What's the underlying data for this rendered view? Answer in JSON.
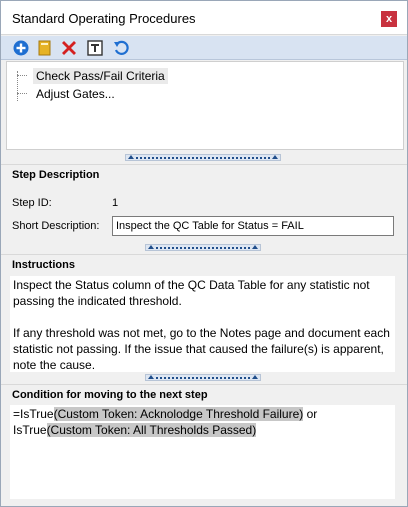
{
  "window": {
    "title": "Standard Operating Procedures",
    "close_label": "x"
  },
  "toolbar": {
    "buttons": [
      {
        "name": "add-icon"
      },
      {
        "name": "folder-icon"
      },
      {
        "name": "delete-icon"
      },
      {
        "name": "rename-icon"
      },
      {
        "name": "refresh-icon"
      }
    ]
  },
  "tree": {
    "items": [
      {
        "label": "Check Pass/Fail Criteria",
        "selected": true
      },
      {
        "label": "Adjust Gates...",
        "selected": false
      }
    ]
  },
  "step_description": {
    "header": "Step Description",
    "step_id_label": "Step ID:",
    "step_id_value": "1",
    "short_desc_label": "Short Description:",
    "short_desc_value": "Inspect the QC Table for Status = FAIL"
  },
  "instructions": {
    "header": "Instructions",
    "paragraph1": "Inspect the Status column of the QC Data Table for any statistic not passing the indicated threshold.",
    "paragraph2": "If any threshold was not met, go to the Notes page and document each statistic not passing. If the issue that caused the failure(s) is apparent, note the cause."
  },
  "condition": {
    "header": "Condition for moving to the next step",
    "prefix1": "=IsTrue",
    "token1": "(Custom Token: Acknolodge Threshold Failure)",
    "mid": " or",
    "prefix2": "IsTrue",
    "token2": "(Custom Token: All Thresholds Passed)"
  }
}
